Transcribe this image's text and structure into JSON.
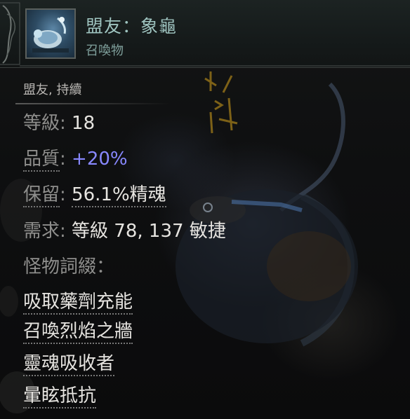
{
  "header": {
    "title": "盟友：象龜",
    "subtitle": "召喚物",
    "portrait_icon": "turtle-minion-portrait-icon"
  },
  "tags": "盟友, 持續",
  "stats": {
    "level": {
      "label": "等級",
      "sep": ": ",
      "value": "18"
    },
    "quality": {
      "label": "品質",
      "sep": ": ",
      "value": "+20%"
    },
    "reservation": {
      "label": "保留",
      "sep": ": ",
      "value": "56.1%精魂"
    },
    "requirements": {
      "label": "需求",
      "sep": ": ",
      "value": "等級 78, 137 敏捷"
    }
  },
  "modifiers": {
    "heading": "怪物詞綴：",
    "items": [
      "吸取藥劑充能",
      "召喚烈焰之牆",
      "靈魂吸收者",
      "暈眩抵抗"
    ]
  },
  "colors": {
    "title": "#9fc4c0",
    "label": "#8e8e8c",
    "value": "#e6e4e0",
    "augmented": "#8888ff",
    "rune_glow": "#8a6a18"
  }
}
